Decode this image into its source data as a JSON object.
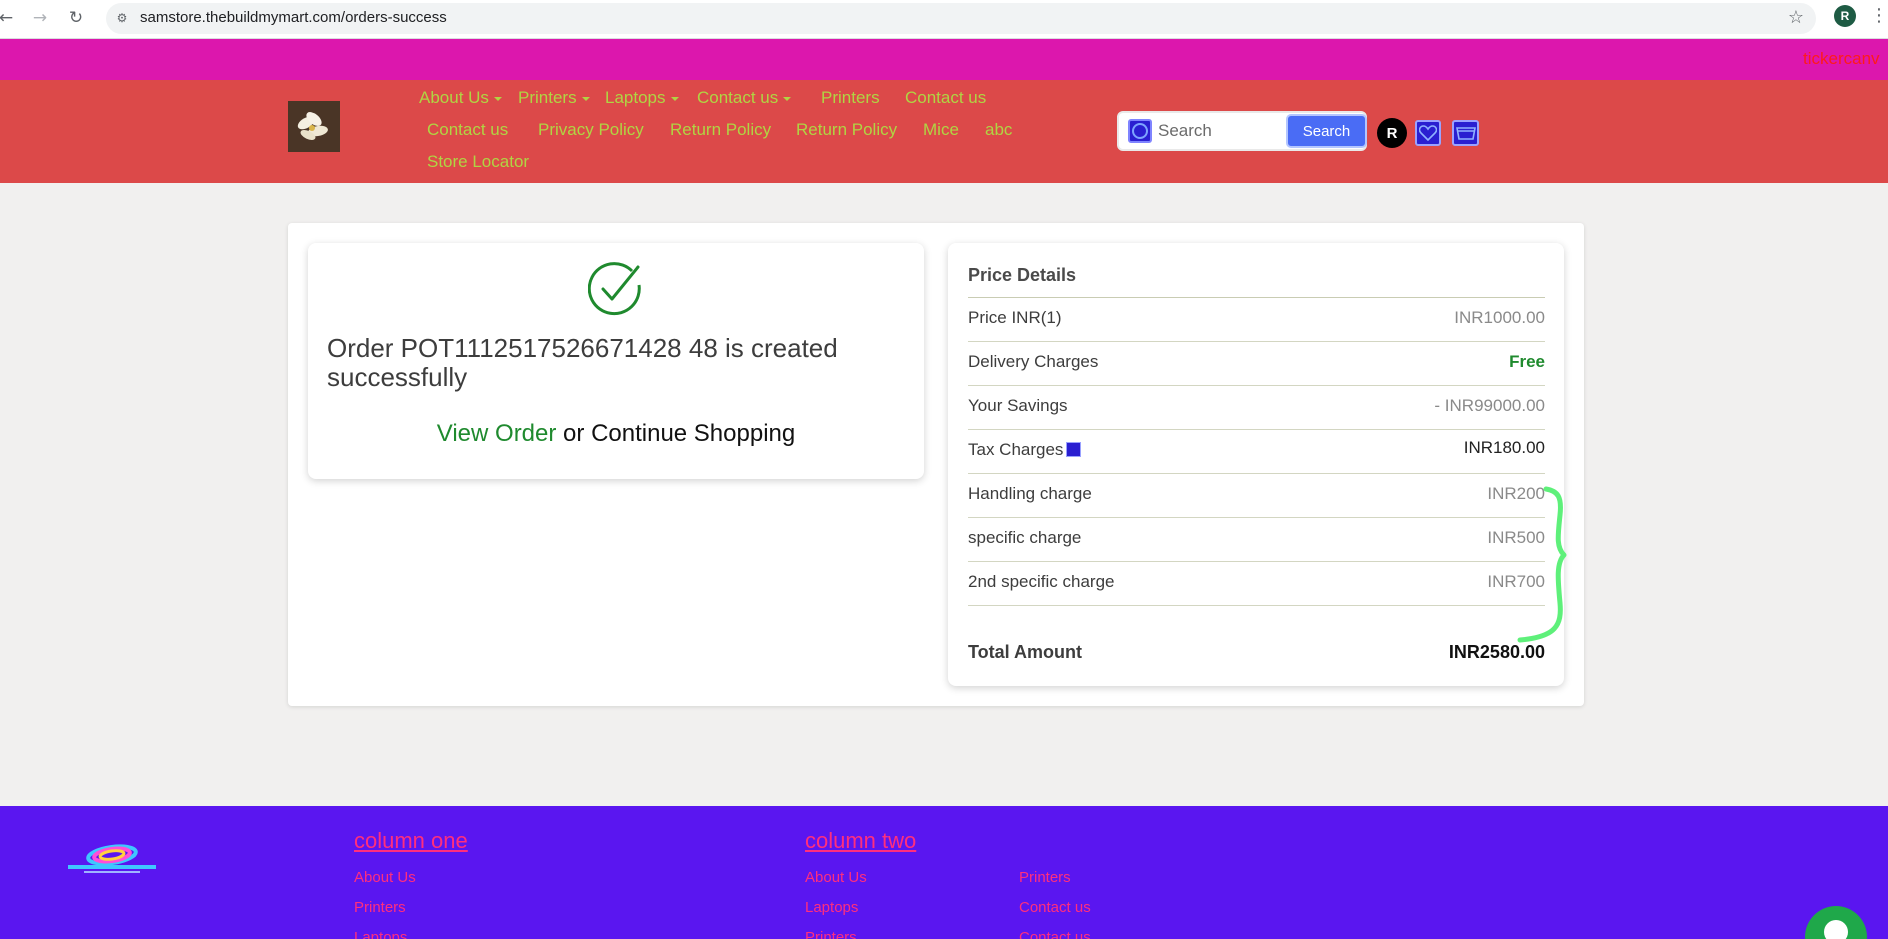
{
  "browser": {
    "url": "samstore.thebuildmymart.com/orders-success",
    "profile_initial": "R"
  },
  "ticker": {
    "text": "tickercanv"
  },
  "header": {
    "nav_row1": [
      {
        "label": "About Us",
        "dropdown": true
      },
      {
        "label": "Printers",
        "dropdown": true
      },
      {
        "label": "Laptops",
        "dropdown": true
      },
      {
        "label": "Contact us",
        "dropdown": true
      },
      {
        "label": "Printers",
        "dropdown": false
      },
      {
        "label": "Contact us",
        "dropdown": false
      }
    ],
    "nav_row2": [
      "Contact us",
      "Privacy Policy",
      "Return Policy",
      "Return Policy",
      "Mice",
      "abc"
    ],
    "nav_row3": [
      "Store Locator"
    ],
    "search": {
      "placeholder": "Search",
      "button_label": "Search"
    },
    "user_initial": "R",
    "colors": {
      "header_bg": "#dc4949",
      "nav_text": "#b0d443",
      "ticker_bg": "#dc17ad"
    }
  },
  "order": {
    "message": "Order POT1112517526671428 48 is created successfully",
    "view_order_label": "View Order",
    "or_text": " or ",
    "continue_label": "Continue Shopping"
  },
  "price_details": {
    "title": "Price Details",
    "rows": [
      {
        "label": "Price INR(1)",
        "value": "INR1000.00"
      },
      {
        "label": "Delivery Charges",
        "value": "Free"
      },
      {
        "label": "Your Savings",
        "value": "- INR99000.00"
      },
      {
        "label": "Tax Charges",
        "value": "INR180.00"
      },
      {
        "label": "Handling charge",
        "value": "INR200"
      },
      {
        "label": "specific charge",
        "value": "INR500"
      },
      {
        "label": "2nd specific charge",
        "value": "INR700"
      }
    ],
    "total_label": "Total Amount",
    "total_value": "INR2580.00"
  },
  "footer": {
    "column_one": {
      "heading": "column one",
      "links": [
        "About Us",
        "Printers",
        "Laptops"
      ]
    },
    "column_two": {
      "heading": "column two",
      "links": [
        "About Us",
        "Laptops",
        "Printers"
      ]
    },
    "column_three": {
      "links": [
        "Printers",
        "Contact us",
        "Contact us"
      ]
    },
    "colors": {
      "bg": "#5a16f0",
      "link": "#ff2e7d"
    }
  }
}
